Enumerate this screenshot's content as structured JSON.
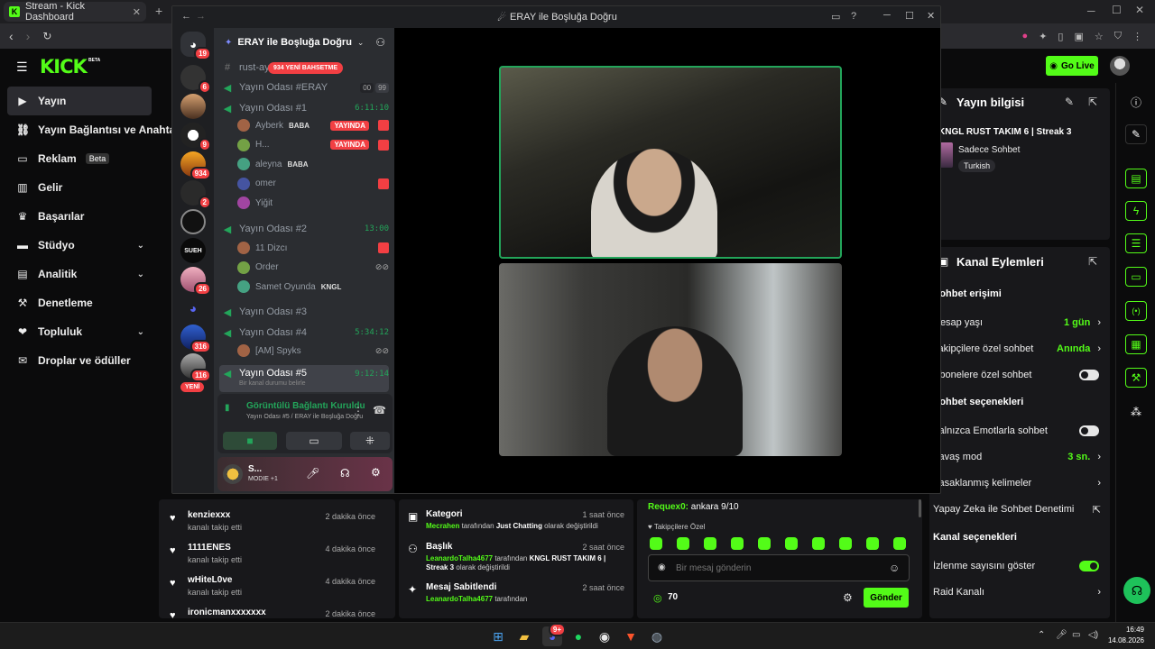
{
  "browser": {
    "tab_title": "Stream - Kick Dashboard",
    "new_tab": "+"
  },
  "kick": {
    "logo": "KICK",
    "logo_sup": "BETA",
    "go_live": "Go Live",
    "sidebar": [
      {
        "label": "Yayın",
        "icon": "broadcast-icon",
        "active": true
      },
      {
        "label": "Yayın Bağlantısı ve Anahtarı",
        "icon": "link-icon"
      },
      {
        "label": "Reklam",
        "icon": "ad-icon",
        "badge": "Beta"
      },
      {
        "label": "Gelir",
        "icon": "revenue-icon"
      },
      {
        "label": "Başarılar",
        "icon": "trophy-icon"
      },
      {
        "label": "Stüdyo",
        "icon": "studio-icon",
        "expandable": true
      },
      {
        "label": "Analitik",
        "icon": "analytics-icon",
        "expandable": true
      },
      {
        "label": "Denetleme",
        "icon": "moderation-icon"
      },
      {
        "label": "Topluluk",
        "icon": "community-icon",
        "expandable": true
      },
      {
        "label": "Droplar ve ödüller",
        "icon": "gift-icon"
      }
    ],
    "stream_info": {
      "heading": "Yayın bilgisi",
      "title": "KNGL RUST TAKIM 6 | Streak 3",
      "category": "Sadece Sohbet",
      "tag": "Turkish"
    },
    "channel_actions": {
      "heading": "Kanal Eylemleri",
      "chat_access": "Sohbet erişimi",
      "rows_access": [
        {
          "label": "Hesap yaşı",
          "value": "1 gün"
        },
        {
          "label": "Takipçilere özel sohbet",
          "value": "Anında"
        },
        {
          "label": "Abonelere özel sohbet",
          "toggle": false
        }
      ],
      "chat_options": "Sohbet seçenekleri",
      "rows_options": [
        {
          "label": "Yalnızca Emotlarla sohbet",
          "toggle": false
        },
        {
          "label": "Yavaş mod",
          "value": "3 sn."
        },
        {
          "label": "Yasaklanmış kelimeler"
        },
        {
          "label": "Yapay Zeka ile Sohbet Denetimi"
        }
      ],
      "channel_options": "Kanal seçenekleri",
      "rows_channel": [
        {
          "label": "İzlenme sayısını göster",
          "toggle": true
        },
        {
          "label": "Raid Kanalı"
        }
      ]
    },
    "followers": [
      {
        "name": "kenziexxx",
        "action": "kanalı takip etti",
        "time": "2 dakika önce"
      },
      {
        "name": "1111ENES",
        "action": "kanalı takip etti",
        "time": "4 dakika önce"
      },
      {
        "name": "wHiteL0ve",
        "action": "kanalı takip etti",
        "time": "4 dakika önce"
      },
      {
        "name": "ironicmanxxxxxxx",
        "action": "",
        "time": "2 dakika önce"
      }
    ],
    "activity": [
      {
        "title": "Kategori",
        "time": "1 saat önce",
        "user": "Mecrahen",
        "mid": " tarafından ",
        "hl": "Just Chatting",
        "tail": " olarak değiştirildi"
      },
      {
        "title": "Başlık",
        "time": "2 saat önce",
        "user": "LeanardoTalha4677",
        "mid": " tarafından ",
        "hl": "KNGL RUST TAKIM 6 | Streak 3",
        "tail": " olarak değiştirildi"
      },
      {
        "title": "Mesaj Sabitlendi",
        "time": "2 saat önce",
        "user": "LeanardoTalha4677",
        "mid": " tarafından",
        "hl": "",
        "tail": ""
      }
    ],
    "chat": {
      "last_user": "Requex0:",
      "last_msg": " ankara 9/10",
      "followers_only": "Takipçilere Özel",
      "placeholder": "Bir mesaj gönderin",
      "points": "70",
      "send": "Gönder"
    }
  },
  "discord": {
    "window_title": "ERAY ile Boşluğa Doğru",
    "server_name": "ERAY ile Boşluğa Doğru",
    "mention_pill": "934 YENİ BAHSETME",
    "new_pill": "YENİ",
    "server_badges": [
      "19",
      "6",
      "9",
      "934",
      "2",
      "",
      "",
      "26",
      "",
      "316",
      "116"
    ],
    "channels": [
      {
        "name": "rust-ayar",
        "type": "text"
      },
      {
        "name": "Yayın Odası #ERAY",
        "type": "voice",
        "counts": [
          "00",
          "99"
        ]
      },
      {
        "name": "Yayın Odası #1",
        "type": "voice",
        "time": "6:11:10"
      },
      {
        "name": "Yayın Odası #2",
        "type": "voice",
        "time": "13:00"
      },
      {
        "name": "Yayın Odası #3",
        "type": "voice"
      },
      {
        "name": "Yayın Odası #4",
        "type": "voice",
        "time": "5:34:12"
      },
      {
        "name": "Yayın Odası #5",
        "type": "voice",
        "time": "9:12:14",
        "status": "Bir kanal durumu belirle"
      }
    ],
    "room1_users": [
      {
        "name": "Ayberk",
        "tag": "BABA",
        "live": "YAYINDA"
      },
      {
        "name": "H...",
        "live": "YAYINDA"
      },
      {
        "name": "aleyna",
        "tag": "BABA"
      },
      {
        "name": "omer"
      },
      {
        "name": "Yiğit"
      }
    ],
    "room2_users": [
      {
        "name": "11 Dizcı"
      },
      {
        "name": "Order"
      },
      {
        "name": "Samet Oyunda",
        "tag": "KNGL"
      }
    ],
    "room4_users": [
      {
        "name": "[AM] Spyks"
      }
    ],
    "voice": {
      "status": "Görüntülü Bağlantı Kuruldu",
      "location": "Yayın Odası #5 / ERAY ile Boşluğa Doğru"
    },
    "self": {
      "name": "S...",
      "sub": "MODIE +1"
    }
  },
  "taskbar": {
    "time": "16:49",
    "date": "14.08.2026",
    "discord_badge": "9+"
  },
  "colors": {
    "kick_green": "#53fc18",
    "discord_red": "#f23f43",
    "discord_green": "#23a55a"
  }
}
